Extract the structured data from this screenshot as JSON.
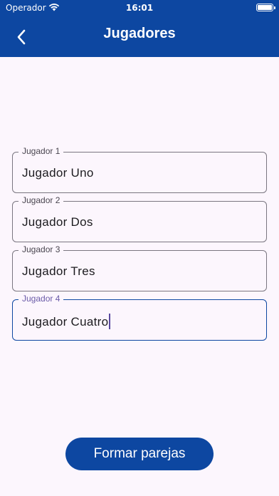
{
  "status_bar": {
    "carrier": "Operador",
    "time": "16:01",
    "icons": [
      "wifi-icon",
      "battery-icon"
    ]
  },
  "app_bar": {
    "title": "Jugadores",
    "back_icon": "chevron-left-icon"
  },
  "fields": [
    {
      "label": "Jugador 1",
      "value": "Jugador Uno",
      "focused": false
    },
    {
      "label": "Jugador 2",
      "value": "Jugador Dos",
      "focused": false
    },
    {
      "label": "Jugador 3",
      "value": "Jugador Tres",
      "focused": false
    },
    {
      "label": "Jugador 4",
      "value": "Jugador Cuatro",
      "focused": true
    }
  ],
  "actions": {
    "primary_label": "Formar parejas"
  },
  "colors": {
    "primary": "#0d47a1",
    "background": "#fcf6fd",
    "focused_label": "#6a5ba8",
    "outline": "#7a7680"
  }
}
